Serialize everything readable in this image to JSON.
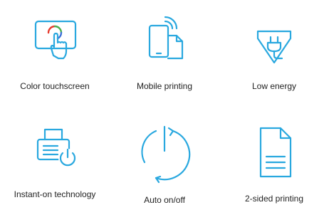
{
  "accent_color": "#29a8df",
  "features": [
    {
      "label": "Color touchscreen",
      "icon": "touchscreen-icon"
    },
    {
      "label": "Mobile printing",
      "icon": "mobile-printing-icon"
    },
    {
      "label": "Low energy",
      "icon": "low-energy-icon"
    },
    {
      "label": "Instant-on technology",
      "icon": "instant-on-icon"
    },
    {
      "label": "Auto on/off",
      "icon": "power-icon"
    },
    {
      "label": "2-sided printing",
      "icon": "duplex-document-icon"
    }
  ]
}
